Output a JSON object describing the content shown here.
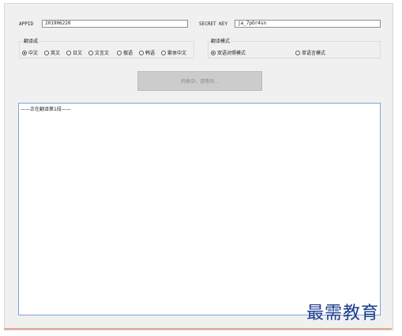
{
  "appid": {
    "label": "APPID",
    "value": "201906220"
  },
  "secret_key": {
    "label": "SECRET KEY",
    "value": "ja_7pOr4sn"
  },
  "engine": {
    "title": "翻译成",
    "options": [
      {
        "label": "中文",
        "checked": true
      },
      {
        "label": "英文",
        "checked": false
      },
      {
        "label": "日文",
        "checked": false
      },
      {
        "label": "文言文",
        "checked": false
      },
      {
        "label": "俄语",
        "checked": false
      },
      {
        "label": "韩语",
        "checked": false
      },
      {
        "label": "繁体中文",
        "checked": false
      }
    ]
  },
  "mode": {
    "title": "翻译模式",
    "options": [
      {
        "label": "双语对照模式",
        "checked": true
      },
      {
        "label": "单语言模式",
        "checked": false
      }
    ]
  },
  "convert_button": {
    "label": "转换中，请等待..."
  },
  "output": {
    "status": "——正在翻译第1段——"
  },
  "watermark": "最需教育"
}
